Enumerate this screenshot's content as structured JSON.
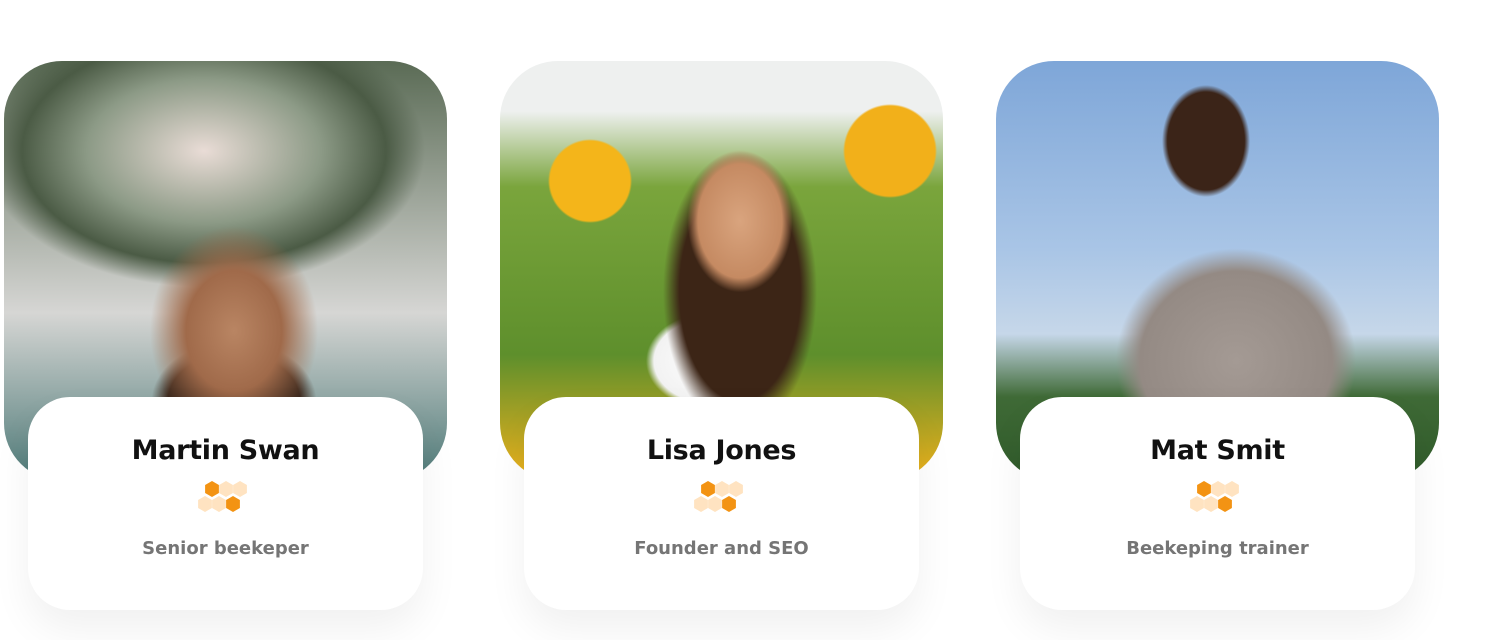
{
  "team": [
    {
      "name": "Martin Swan",
      "role": "Senior beekeper",
      "photo": "man-with-flower-crown-photo"
    },
    {
      "name": "Lisa Jones",
      "role": "Founder and SEO",
      "photo": "woman-in-sunflower-field-photo"
    },
    {
      "name": "Mat Smit",
      "role": "Beekeping trainer",
      "photo": "man-in-sweater-sky-photo"
    }
  ],
  "colors": {
    "accent": "#F39313",
    "accent_light": "#FFE3C1",
    "name": "#111111",
    "role": "#757575"
  }
}
